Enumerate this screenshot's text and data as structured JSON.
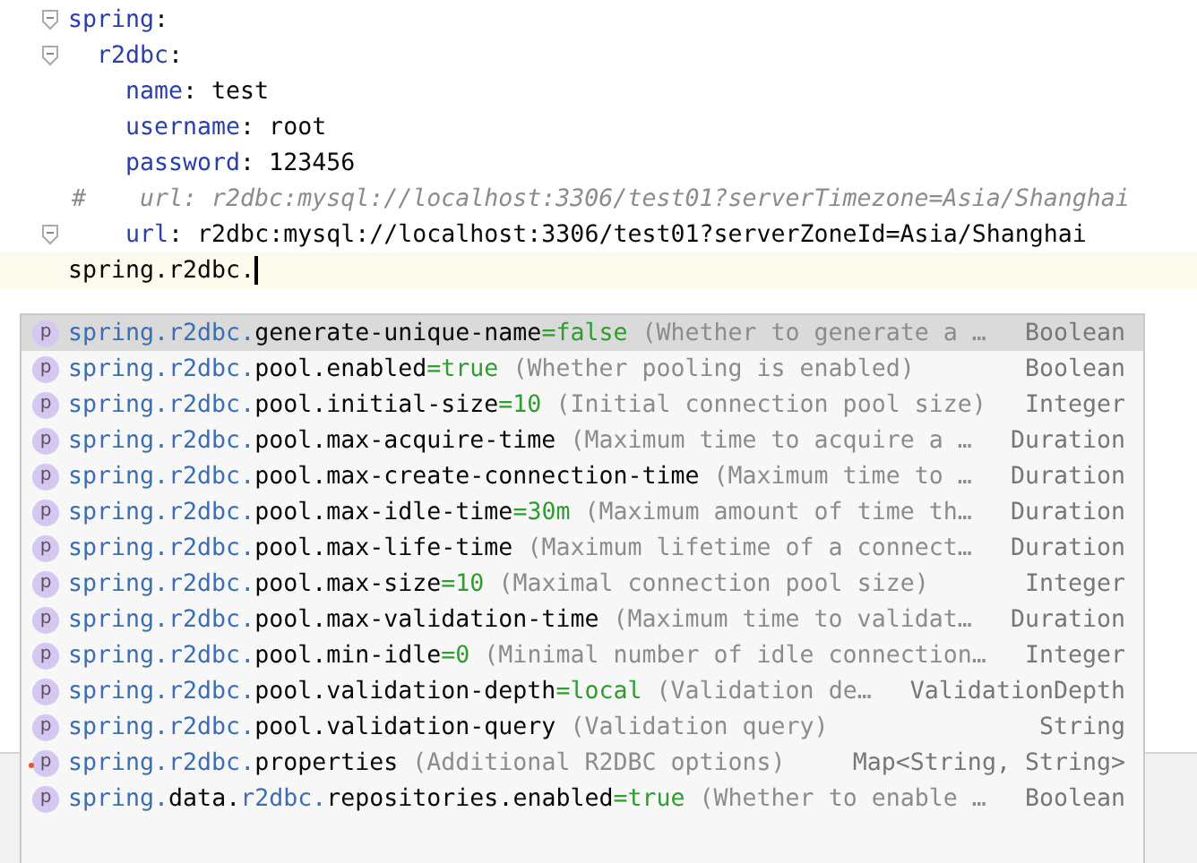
{
  "editor": {
    "lines": [
      {
        "kind": "key",
        "key": "spring",
        "colon": ":",
        "foldable": true,
        "children": [
          {
            "kind": "key",
            "key": "r2dbc",
            "colon": ":",
            "foldable": true,
            "children": [
              {
                "kind": "pair",
                "key": "name",
                "colon": ":",
                "value": "test"
              },
              {
                "kind": "pair",
                "key": "username",
                "colon": ":",
                "value": "root"
              },
              {
                "kind": "pair",
                "key": "password",
                "colon": ":",
                "value": "123456"
              },
              {
                "kind": "comment",
                "marker": "#",
                "text": "url: r2dbc:mysql://localhost:3306/test01?serverTimezone=Asia/Shanghai"
              },
              {
                "kind": "pair",
                "key": "url",
                "colon": ":",
                "value": "r2dbc:mysql://localhost:3306/test01?serverZoneId=Asia/Shanghai",
                "foldable": true
              }
            ]
          }
        ]
      },
      {
        "kind": "typing",
        "text": "spring.r2dbc.",
        "current": true
      }
    ]
  },
  "completion": {
    "items": [
      {
        "icon": "p",
        "parts": [
          {
            "text": "spring.r2dbc.",
            "matched": true
          },
          {
            "text": "generate-unique-name",
            "matched": false
          }
        ],
        "value": "=false",
        "description": "(Whether to generate a …",
        "type": "Boolean",
        "selected": true,
        "flag": false
      },
      {
        "icon": "p",
        "parts": [
          {
            "text": "spring.r2dbc.",
            "matched": true
          },
          {
            "text": "pool.enabled",
            "matched": false
          }
        ],
        "value": "=true",
        "description": "(Whether pooling is enabled)",
        "type": "Boolean",
        "selected": false,
        "flag": false
      },
      {
        "icon": "p",
        "parts": [
          {
            "text": "spring.r2dbc.",
            "matched": true
          },
          {
            "text": "pool.initial-size",
            "matched": false
          }
        ],
        "value": "=10",
        "description": "(Initial connection pool size)",
        "type": "Integer",
        "selected": false,
        "flag": false
      },
      {
        "icon": "p",
        "parts": [
          {
            "text": "spring.r2dbc.",
            "matched": true
          },
          {
            "text": "pool.max-acquire-time",
            "matched": false
          }
        ],
        "description": "(Maximum time to acquire a …",
        "type": "Duration",
        "selected": false,
        "flag": false
      },
      {
        "icon": "p",
        "parts": [
          {
            "text": "spring.r2dbc.",
            "matched": true
          },
          {
            "text": "pool.max-create-connection-time",
            "matched": false
          }
        ],
        "description": "(Maximum time to …",
        "type": "Duration",
        "selected": false,
        "flag": false
      },
      {
        "icon": "p",
        "parts": [
          {
            "text": "spring.r2dbc.",
            "matched": true
          },
          {
            "text": "pool.max-idle-time",
            "matched": false
          }
        ],
        "value": "=30m",
        "description": "(Maximum amount of time th…",
        "type": "Duration",
        "selected": false,
        "flag": false
      },
      {
        "icon": "p",
        "parts": [
          {
            "text": "spring.r2dbc.",
            "matched": true
          },
          {
            "text": "pool.max-life-time",
            "matched": false
          }
        ],
        "description": "(Maximum lifetime of a connect…",
        "type": "Duration",
        "selected": false,
        "flag": false
      },
      {
        "icon": "p",
        "parts": [
          {
            "text": "spring.r2dbc.",
            "matched": true
          },
          {
            "text": "pool.max-size",
            "matched": false
          }
        ],
        "value": "=10",
        "description": "(Maximal connection pool size)",
        "type": "Integer",
        "selected": false,
        "flag": false
      },
      {
        "icon": "p",
        "parts": [
          {
            "text": "spring.r2dbc.",
            "matched": true
          },
          {
            "text": "pool.max-validation-time",
            "matched": false
          }
        ],
        "description": "(Maximum time to validat…",
        "type": "Duration",
        "selected": false,
        "flag": false
      },
      {
        "icon": "p",
        "parts": [
          {
            "text": "spring.r2dbc.",
            "matched": true
          },
          {
            "text": "pool.min-idle",
            "matched": false
          }
        ],
        "value": "=0",
        "description": "(Minimal number of idle connection…",
        "type": "Integer",
        "selected": false,
        "flag": false
      },
      {
        "icon": "p",
        "parts": [
          {
            "text": "spring.r2dbc.",
            "matched": true
          },
          {
            "text": "pool.validation-depth",
            "matched": false
          }
        ],
        "value": "=local",
        "description": "(Validation de…",
        "type": "ValidationDepth",
        "selected": false,
        "flag": false
      },
      {
        "icon": "p",
        "parts": [
          {
            "text": "spring.r2dbc.",
            "matched": true
          },
          {
            "text": "pool.validation-query",
            "matched": false
          }
        ],
        "description": "(Validation query)",
        "type": "String",
        "selected": false,
        "flag": false
      },
      {
        "icon": "p",
        "parts": [
          {
            "text": "spring.r2dbc.",
            "matched": true
          },
          {
            "text": "properties",
            "matched": false
          }
        ],
        "description": "(Additional R2DBC options)",
        "type": "Map<String, String>",
        "selected": false,
        "flag": true
      },
      {
        "icon": "p",
        "parts": [
          {
            "text": "spring.",
            "matched": true
          },
          {
            "text": "data.",
            "matched": false
          },
          {
            "text": "r2dbc.",
            "matched": true
          },
          {
            "text": "repositories.enabled",
            "matched": false
          }
        ],
        "value": "=true",
        "description": "(Whether to enable …",
        "type": "Boolean",
        "selected": false,
        "flag": false
      }
    ]
  }
}
